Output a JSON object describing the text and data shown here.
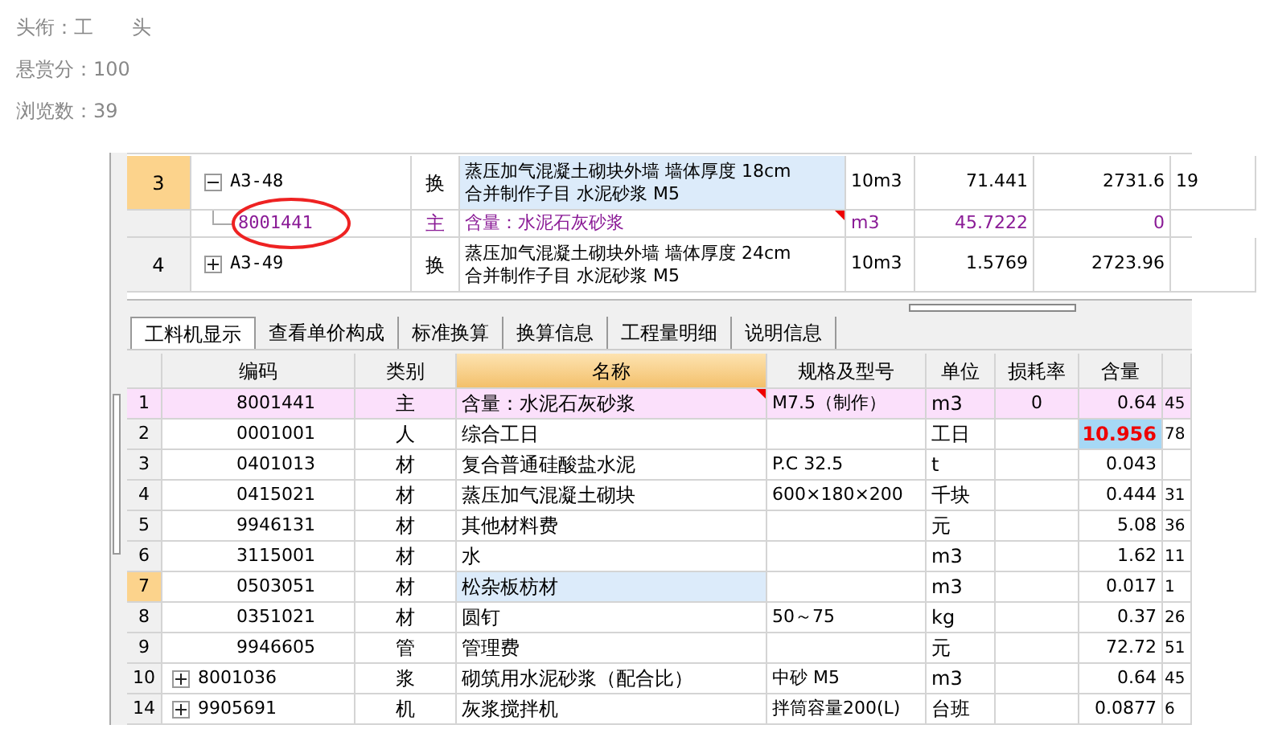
{
  "profile": {
    "lines": [
      "头衔：工　　头",
      "悬赏分：100",
      "浏览数：39"
    ]
  },
  "upper_grid": {
    "rows": [
      {
        "index": "3",
        "code": "A3-48",
        "expanded": true,
        "type": "换",
        "name": [
          "蒸压加气混凝土砌块外墙 墙体厚度 18cm",
          "合并制作子目 水泥砂浆 M5"
        ],
        "unit": "10m3",
        "quantity": "71.441",
        "price": "2731.6",
        "column_8": "19",
        "selected": true,
        "children": [
          {
            "code": "8001441",
            "type": "主",
            "name": [
              "含量：水泥石灰砂浆"
            ],
            "unit": "m3",
            "quantity": "45.7222",
            "price": "0",
            "note": true,
            "circled": true
          }
        ]
      },
      {
        "index": "4",
        "code": "A3-49",
        "expanded": false,
        "type": "换",
        "name": [
          "蒸压加气混凝土砌块外墙 墙体厚度 24cm",
          "合并制作子目 水泥砂浆 M5"
        ],
        "unit": "10m3",
        "quantity": "1.5769",
        "price": "2723.96",
        "selected": false
      }
    ]
  },
  "tabs": [
    {
      "label": "工料机显示",
      "selected": true
    },
    {
      "label": "查看单价构成",
      "selected": false
    },
    {
      "label": "标准换算",
      "selected": false
    },
    {
      "label": "换算信息",
      "selected": false
    },
    {
      "label": "工程量明细",
      "selected": false
    },
    {
      "label": "说明信息",
      "selected": false
    }
  ],
  "table": {
    "columns": [
      {
        "label": "编码",
        "sorted": false
      },
      {
        "label": "类别",
        "sorted": false
      },
      {
        "label": "名称",
        "sorted": true
      },
      {
        "label": "规格及型号",
        "sorted": false
      },
      {
        "label": "单位",
        "sorted": false
      },
      {
        "label": "损耗率",
        "sorted": false
      },
      {
        "label": "含量",
        "sorted": false
      }
    ],
    "rows": [
      {
        "index": "1",
        "code": "8001441",
        "type": "主",
        "name": "含量：水泥石灰砂浆",
        "spec": "M7.5（制作）",
        "unit": "m3",
        "loss": "0",
        "amount": "0.64",
        "column_8": "45",
        "kind": "main",
        "note": true,
        "selected": false
      },
      {
        "index": "2",
        "code": "0001001",
        "type": "人",
        "name": "综合工日",
        "unit": "工日",
        "amount": "10.956",
        "column_8": "78",
        "kind": "normal",
        "amount_highlight": true,
        "selected": false
      },
      {
        "index": "3",
        "code": "0401013",
        "type": "材",
        "name": "复合普通硅酸盐水泥",
        "spec": "P.C  32.5",
        "unit": "t",
        "amount": "0.043",
        "kind": "normal",
        "selected": false
      },
      {
        "index": "4",
        "code": "0415021",
        "type": "材",
        "name": "蒸压加气混凝土砌块",
        "spec": "600×180×200",
        "unit": "千块",
        "amount": "0.444",
        "column_8": "31",
        "kind": "normal",
        "selected": false
      },
      {
        "index": "5",
        "code": "9946131",
        "type": "材",
        "name": "其他材料费",
        "unit": "元",
        "amount": "5.08",
        "column_8": "36",
        "kind": "normal",
        "selected": false
      },
      {
        "index": "6",
        "code": "3115001",
        "type": "材",
        "name": "水",
        "unit": "m3",
        "amount": "1.62",
        "column_8": "11",
        "kind": "normal",
        "selected": false
      },
      {
        "index": "7",
        "code": "0503051",
        "type": "材",
        "name": "松杂板枋材",
        "unit": "m3",
        "amount": "0.017",
        "column_8": "1",
        "kind": "normal",
        "selected": true
      },
      {
        "index": "8",
        "code": "0351021",
        "type": "材",
        "name": "圆钉",
        "spec": "50～75",
        "unit": "kg",
        "amount": "0.37",
        "column_8": "26",
        "kind": "normal",
        "selected": false
      },
      {
        "index": "9",
        "code": "9946605",
        "type": "管",
        "name": "管理费",
        "unit": "元",
        "amount": "72.72",
        "column_8": "51",
        "kind": "normal",
        "selected": false
      },
      {
        "index": "10",
        "code": "8001036",
        "expanded": false,
        "type": "浆",
        "name": "砌筑用水泥砂浆（配合比）",
        "spec": "中砂 M5",
        "unit": "m3",
        "amount": "0.64",
        "column_8": "45",
        "kind": "normal",
        "selected": false
      },
      {
        "index": "14",
        "code": "9905691",
        "expanded": false,
        "type": "机",
        "name": "灰浆搅拌机",
        "spec": "拌筒容量200(L)",
        "unit": "台班",
        "amount": "0.0877",
        "column_8": "6",
        "kind": "normal",
        "selected": false
      }
    ]
  }
}
